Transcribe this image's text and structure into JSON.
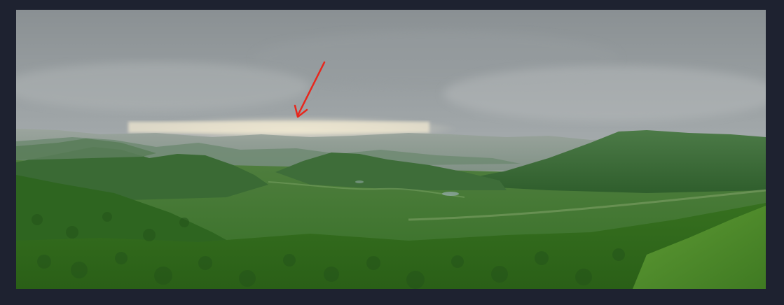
{
  "image": {
    "kind": "panoramic landscape photograph",
    "accent_arrow_color": "#e8261c",
    "colors": {
      "frame_background": "#1e2230",
      "sky_top": "#8e9497",
      "sky_bottom": "#c4c8c6",
      "horizon_glow": "#efe9d6",
      "far_hills": "#7f8e86",
      "mid_hills": "#3f6e3c",
      "foreground": "#2f6a22"
    }
  }
}
